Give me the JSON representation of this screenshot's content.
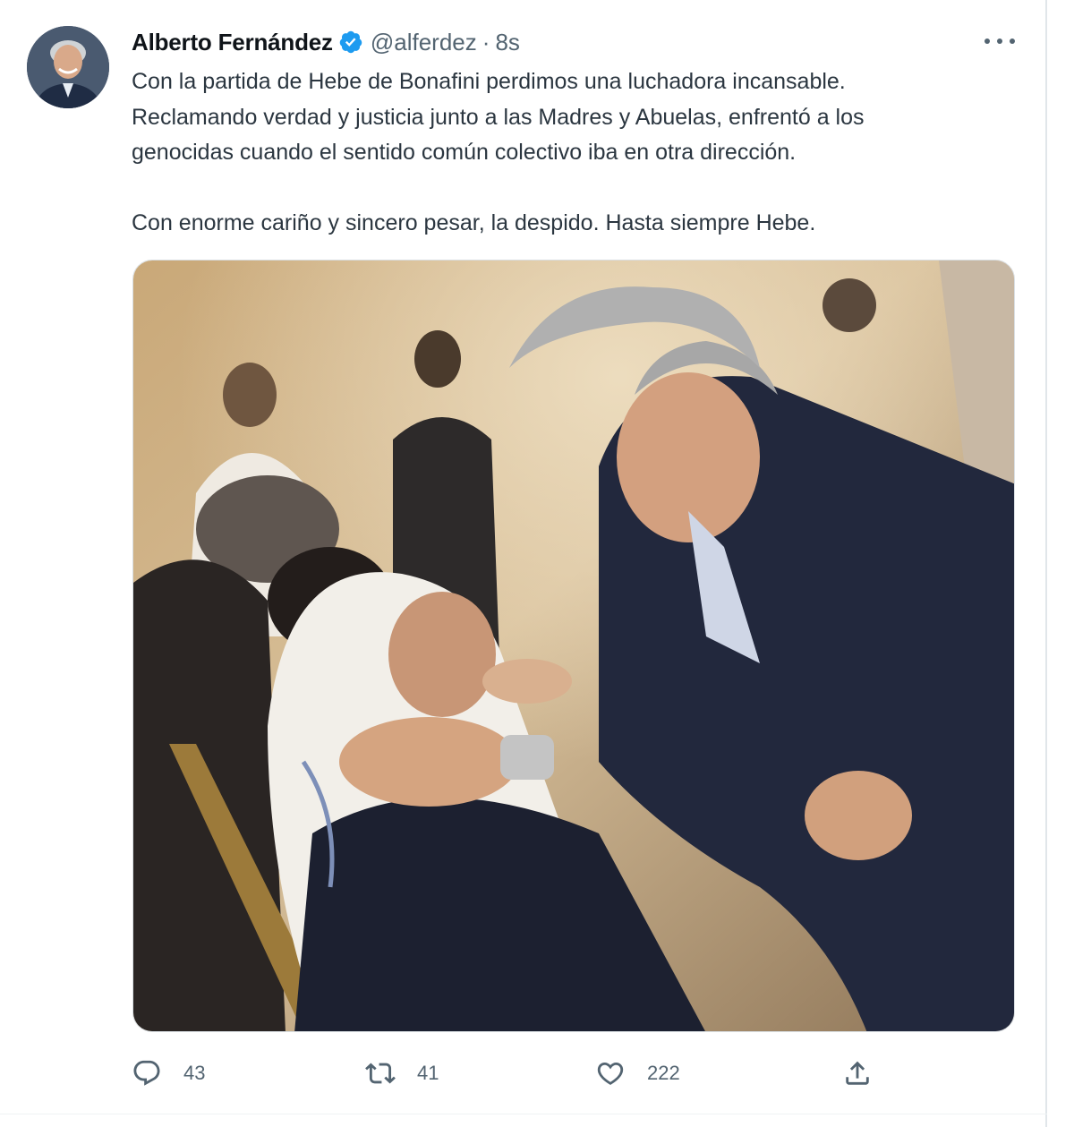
{
  "tweet": {
    "author": {
      "name": "Alberto Fernández",
      "handle": "@alferdez",
      "verified": true
    },
    "separator": "·",
    "time": "8s",
    "text_lines": [
      "Con la partida de Hebe de Bonafini perdimos una luchadora incansable.",
      "Reclamando verdad y justicia junto a las Madres y Abuelas, enfrentó a los",
      "genocidas cuando el sentido común colectivo iba en otra dirección."
    ],
    "text_closing": "Con enorme cariño y sincero pesar, la despido. Hasta siempre Hebe.",
    "media_icon": "photo",
    "actions": {
      "reply_count": "43",
      "retweet_count": "41",
      "like_count": "222"
    },
    "colors": {
      "verified": "#1d9bf0",
      "secondary_text": "#536471",
      "primary_text": "#0f1419"
    },
    "icons": [
      "avatar",
      "verified-badge-icon",
      "more-options-icon",
      "reply-icon",
      "retweet-icon",
      "like-icon",
      "share-icon"
    ]
  }
}
